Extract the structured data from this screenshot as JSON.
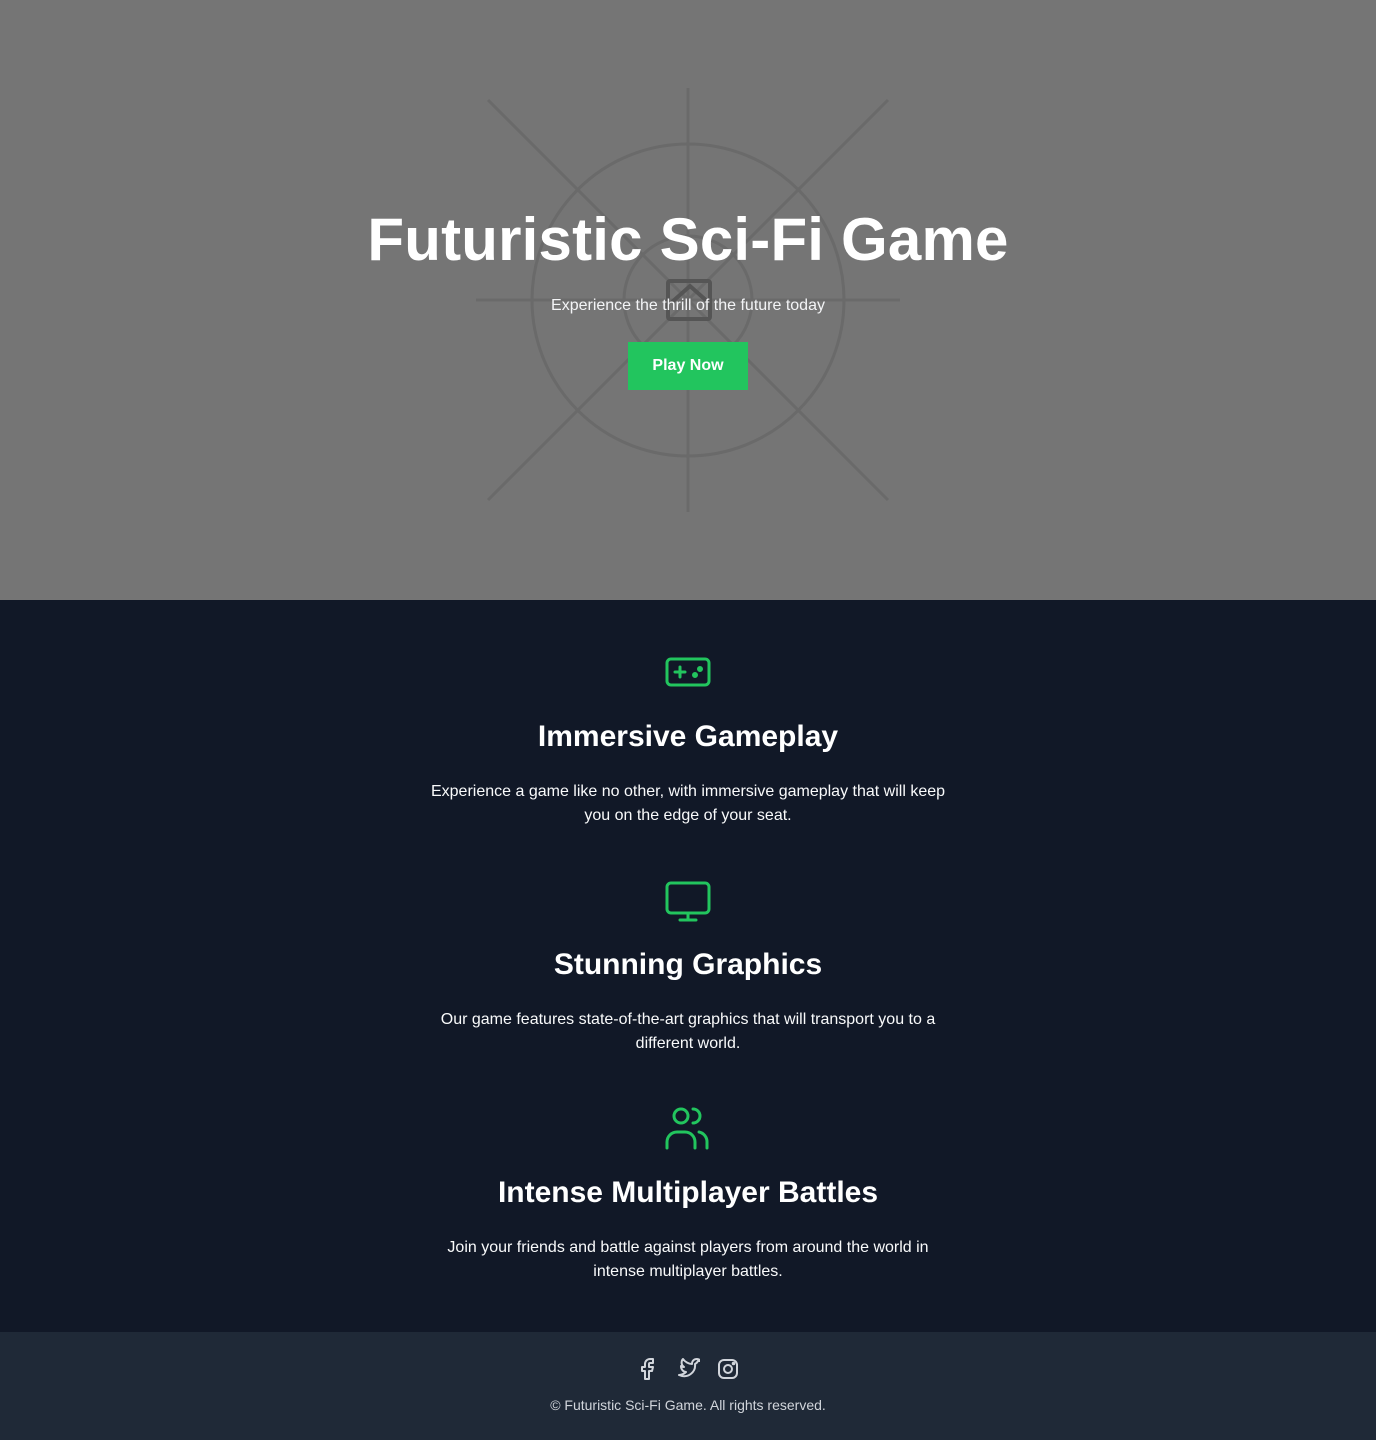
{
  "hero": {
    "title": "Futuristic Sci-Fi Game",
    "subtitle": "Experience the thrill of the future today",
    "cta_label": "Play Now"
  },
  "features": [
    {
      "icon": "gamepad-icon",
      "title": "Immersive Gameplay",
      "text": "Experience a game like no other, with immersive gameplay that will keep you on the edge of your seat."
    },
    {
      "icon": "monitor-icon",
      "title": "Stunning Graphics",
      "text": "Our game features state-of-the-art graphics that will transport you to a different world."
    },
    {
      "icon": "users-icon",
      "title": "Intense Multiplayer Battles",
      "text": "Join your friends and battle against players from around the world in intense multiplayer battles."
    }
  ],
  "footer": {
    "social_icons": [
      "facebook-icon",
      "twitter-icon",
      "instagram-icon"
    ],
    "copyright": "© Futuristic Sci-Fi Game. All rights reserved."
  },
  "colors": {
    "hero_background": "#757575",
    "accent": "#22c55e",
    "page_background": "#111827",
    "footer_background": "#1f2937",
    "footer_text": "#d1d5db"
  }
}
